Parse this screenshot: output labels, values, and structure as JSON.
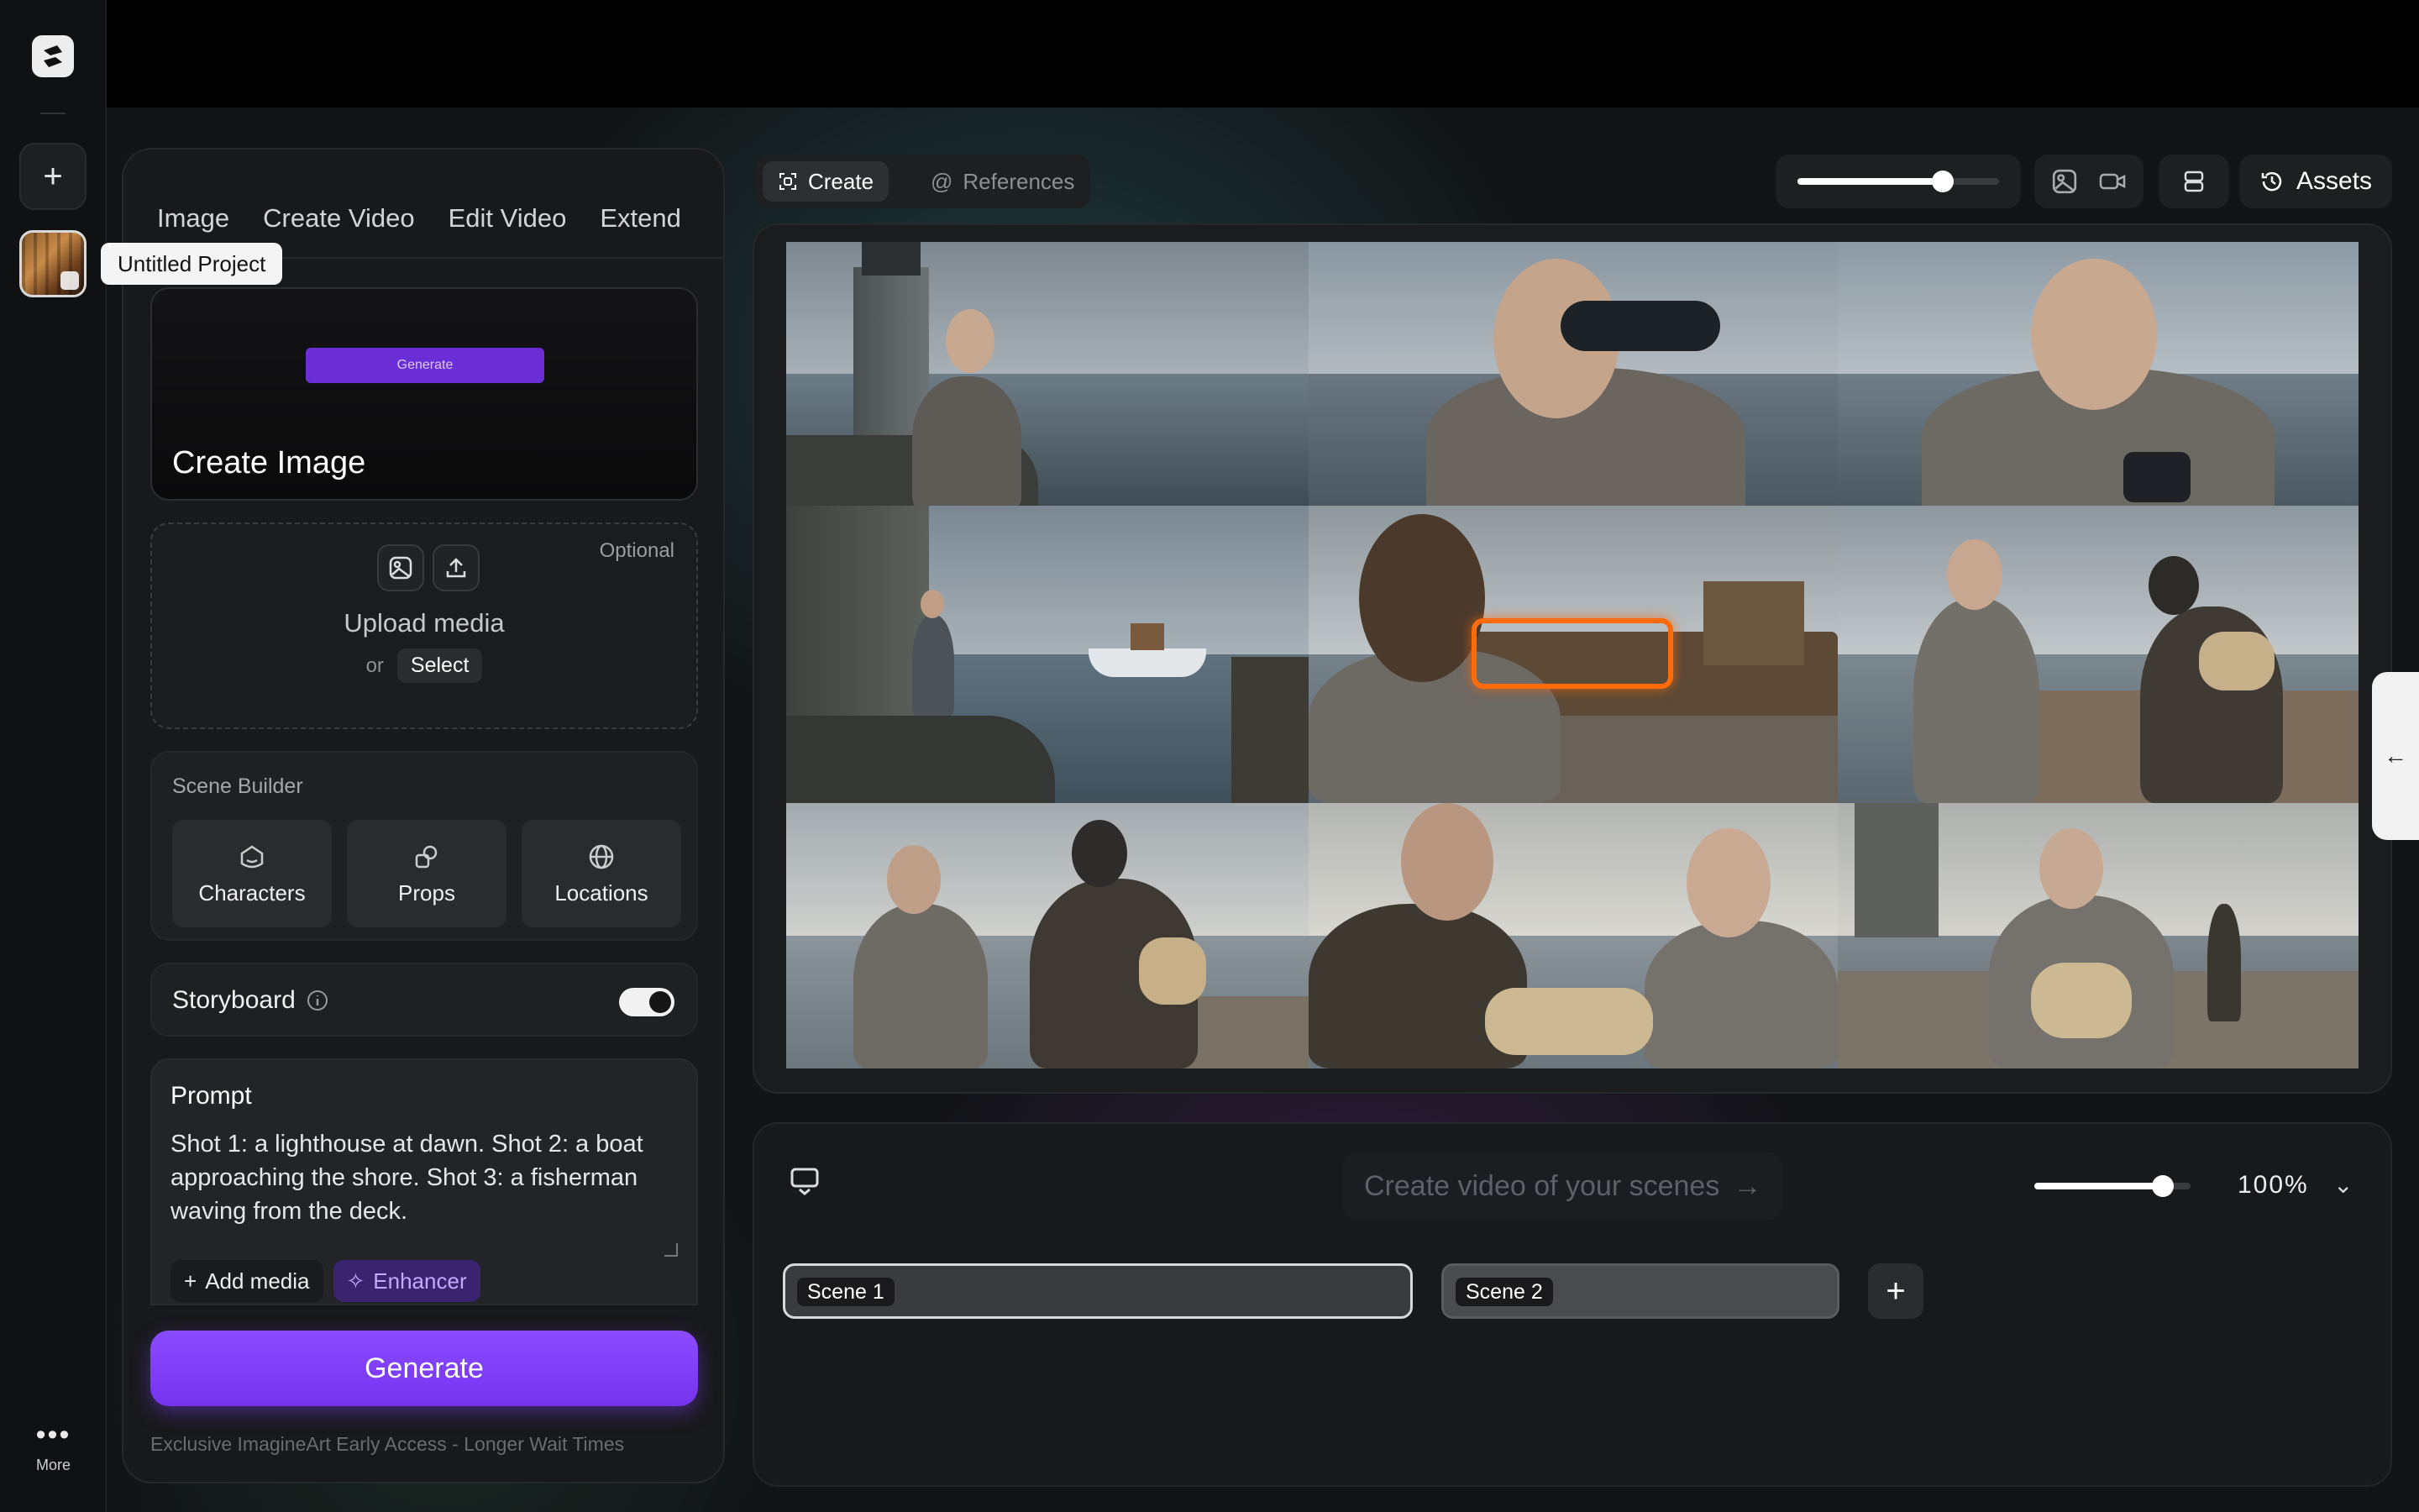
{
  "app": {
    "project_name": "Untitled Project",
    "more_label": "More"
  },
  "panel": {
    "tabs": [
      "Image",
      "Create Video",
      "Edit Video",
      "Extend"
    ],
    "hero": {
      "button_label": "Generate",
      "title": "Create Image"
    },
    "upload": {
      "optional": "Optional",
      "title": "Upload media",
      "or": "or",
      "select": "Select"
    },
    "scene_builder": {
      "title": "Scene Builder",
      "items": [
        "Characters",
        "Props",
        "Locations"
      ]
    },
    "storyboard": {
      "label": "Storyboard",
      "enabled": true
    },
    "prompt": {
      "title": "Prompt",
      "text": "Shot 1: a lighthouse at dawn. Shot 2: a boat approaching the shore. Shot 3: a fisherman waving from the deck.",
      "add_media": "Add media",
      "enhancer": "Enhancer"
    },
    "generate": "Generate",
    "note": "Exclusive ImagineArt Early Access - Longer Wait Times"
  },
  "toolbar": {
    "create": "Create",
    "references": "References",
    "size_slider": 0.72,
    "assets": "Assets"
  },
  "grid": {
    "shots": [
      "lighthouse-woman",
      "woman-binoculars",
      "woman-holding-binoculars",
      "stairs-boat",
      "woman-watching-boat",
      "woman-meets-fisherman",
      "pier-encounter",
      "package-handover",
      "woman-with-package"
    ],
    "highlighted_shot": 5
  },
  "timeline": {
    "cta": "Create video of your scenes",
    "zoom": 0.82,
    "zoom_label": "100%",
    "scenes": [
      "Scene 1",
      "Scene 2"
    ]
  },
  "colors": {
    "accent": "#7a3cf0",
    "highlight": "#ff6a0a"
  }
}
